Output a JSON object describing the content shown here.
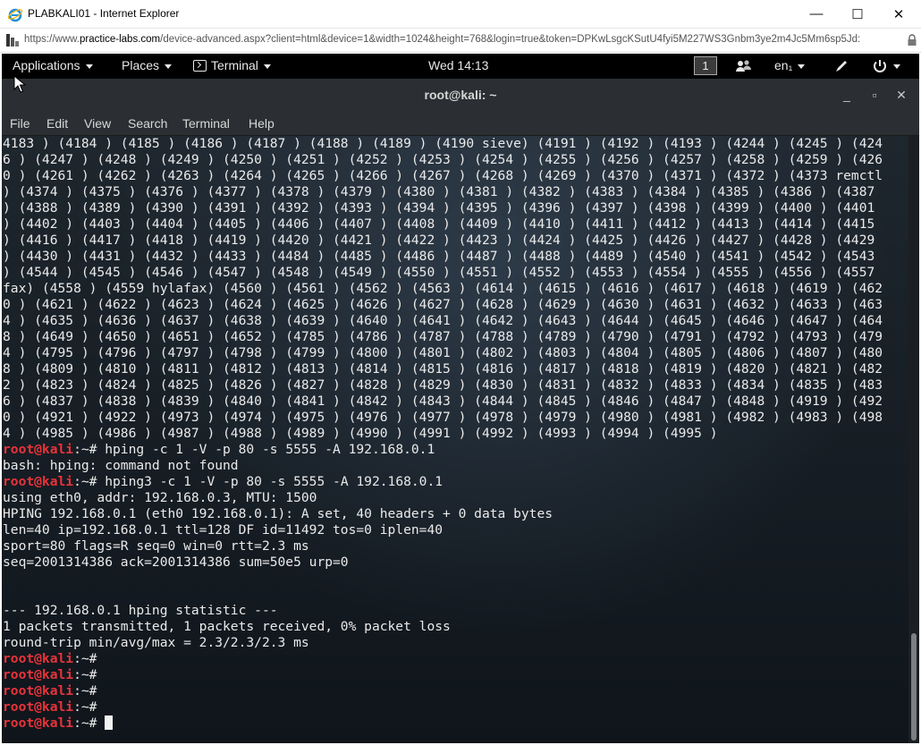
{
  "browser": {
    "window_title": "PLABKALI01 - Internet Explorer",
    "address_prefix": "https://www.",
    "address_host": "practice-labs.com",
    "address_rest": "/device-advanced.aspx?client=html&device=1&width=1024&height=768&login=true&token=DPKwLsgcKSutU4fyi5M227WS3Gnbm3ye2m4Jc5Mm6sp5Jd:",
    "controls": {
      "minimize": "—",
      "maximize": "☐",
      "close": "✕"
    }
  },
  "gnome_bar": {
    "applications": "Applications",
    "places": "Places",
    "terminal": "Terminal",
    "clock": "Wed 14:13",
    "workspace": "1",
    "keyboard": "en₁",
    "icons": [
      "people-icon",
      "keyboard-layout-icon",
      "pen-icon",
      "power-icon"
    ]
  },
  "terminal_window": {
    "title": "root@kali: ~",
    "controls": {
      "minimize": "_",
      "maximize": "▫",
      "close": "✕"
    },
    "menu": [
      "File",
      "Edit",
      "View",
      "Search",
      "Terminal",
      "Help"
    ]
  },
  "terminal": {
    "prompt_user": "root@kali",
    "prompt_path": ":~# ",
    "lines": [
      {
        "t": "out",
        "text": "4183 ) (4184 ) (4185 ) (4186 ) (4187 ) (4188 ) (4189 ) (4190 sieve) (4191 ) (4192 ) (4193 ) (4244 ) (4245 ) (424"
      },
      {
        "t": "out",
        "text": "6 ) (4247 ) (4248 ) (4249 ) (4250 ) (4251 ) (4252 ) (4253 ) (4254 ) (4255 ) (4256 ) (4257 ) (4258 ) (4259 ) (426"
      },
      {
        "t": "out",
        "text": "0 ) (4261 ) (4262 ) (4263 ) (4264 ) (4265 ) (4266 ) (4267 ) (4268 ) (4269 ) (4370 ) (4371 ) (4372 ) (4373 remctl"
      },
      {
        "t": "out",
        "text": ") (4374 ) (4375 ) (4376 ) (4377 ) (4378 ) (4379 ) (4380 ) (4381 ) (4382 ) (4383 ) (4384 ) (4385 ) (4386 ) (4387"
      },
      {
        "t": "out",
        "text": ") (4388 ) (4389 ) (4390 ) (4391 ) (4392 ) (4393 ) (4394 ) (4395 ) (4396 ) (4397 ) (4398 ) (4399 ) (4400 ) (4401"
      },
      {
        "t": "out",
        "text": ") (4402 ) (4403 ) (4404 ) (4405 ) (4406 ) (4407 ) (4408 ) (4409 ) (4410 ) (4411 ) (4412 ) (4413 ) (4414 ) (4415"
      },
      {
        "t": "out",
        "text": ") (4416 ) (4417 ) (4418 ) (4419 ) (4420 ) (4421 ) (4422 ) (4423 ) (4424 ) (4425 ) (4426 ) (4427 ) (4428 ) (4429"
      },
      {
        "t": "out",
        "text": ") (4430 ) (4431 ) (4432 ) (4433 ) (4484 ) (4485 ) (4486 ) (4487 ) (4488 ) (4489 ) (4540 ) (4541 ) (4542 ) (4543"
      },
      {
        "t": "out",
        "text": ") (4544 ) (4545 ) (4546 ) (4547 ) (4548 ) (4549 ) (4550 ) (4551 ) (4552 ) (4553 ) (4554 ) (4555 ) (4556 ) (4557"
      },
      {
        "t": "out",
        "text": "fax) (4558 ) (4559 hylafax) (4560 ) (4561 ) (4562 ) (4563 ) (4614 ) (4615 ) (4616 ) (4617 ) (4618 ) (4619 ) (462"
      },
      {
        "t": "out",
        "text": "0 ) (4621 ) (4622 ) (4623 ) (4624 ) (4625 ) (4626 ) (4627 ) (4628 ) (4629 ) (4630 ) (4631 ) (4632 ) (4633 ) (463"
      },
      {
        "t": "out",
        "text": "4 ) (4635 ) (4636 ) (4637 ) (4638 ) (4639 ) (4640 ) (4641 ) (4642 ) (4643 ) (4644 ) (4645 ) (4646 ) (4647 ) (464"
      },
      {
        "t": "out",
        "text": "8 ) (4649 ) (4650 ) (4651 ) (4652 ) (4785 ) (4786 ) (4787 ) (4788 ) (4789 ) (4790 ) (4791 ) (4792 ) (4793 ) (479"
      },
      {
        "t": "out",
        "text": "4 ) (4795 ) (4796 ) (4797 ) (4798 ) (4799 ) (4800 ) (4801 ) (4802 ) (4803 ) (4804 ) (4805 ) (4806 ) (4807 ) (480"
      },
      {
        "t": "out",
        "text": "8 ) (4809 ) (4810 ) (4811 ) (4812 ) (4813 ) (4814 ) (4815 ) (4816 ) (4817 ) (4818 ) (4819 ) (4820 ) (4821 ) (482"
      },
      {
        "t": "out",
        "text": "2 ) (4823 ) (4824 ) (4825 ) (4826 ) (4827 ) (4828 ) (4829 ) (4830 ) (4831 ) (4832 ) (4833 ) (4834 ) (4835 ) (483"
      },
      {
        "t": "out",
        "text": "6 ) (4837 ) (4838 ) (4839 ) (4840 ) (4841 ) (4842 ) (4843 ) (4844 ) (4845 ) (4846 ) (4847 ) (4848 ) (4919 ) (492"
      },
      {
        "t": "out",
        "text": "0 ) (4921 ) (4922 ) (4973 ) (4974 ) (4975 ) (4976 ) (4977 ) (4978 ) (4979 ) (4980 ) (4981 ) (4982 ) (4983 ) (498"
      },
      {
        "t": "out",
        "text": "4 ) (4985 ) (4986 ) (4987 ) (4988 ) (4989 ) (4990 ) (4991 ) (4992 ) (4993 ) (4994 ) (4995 )"
      },
      {
        "t": "cmd",
        "text": "hping -c 1 -V -p 80 -s 5555 -A 192.168.0.1"
      },
      {
        "t": "out",
        "text": "bash: hping: command not found"
      },
      {
        "t": "cmd",
        "text": "hping3 -c 1 -V -p 80 -s 5555 -A 192.168.0.1"
      },
      {
        "t": "out",
        "text": "using eth0, addr: 192.168.0.3, MTU: 1500"
      },
      {
        "t": "out",
        "text": "HPING 192.168.0.1 (eth0 192.168.0.1): A set, 40 headers + 0 data bytes"
      },
      {
        "t": "out",
        "text": "len=40 ip=192.168.0.1 ttl=128 DF id=11492 tos=0 iplen=40"
      },
      {
        "t": "out",
        "text": "sport=80 flags=R seq=0 win=0 rtt=2.3 ms"
      },
      {
        "t": "out",
        "text": "seq=2001314386 ack=2001314386 sum=50e5 urp=0"
      },
      {
        "t": "out",
        "text": ""
      },
      {
        "t": "out",
        "text": ""
      },
      {
        "t": "out",
        "text": "--- 192.168.0.1 hping statistic ---"
      },
      {
        "t": "out",
        "text": "1 packets transmitted, 1 packets received, 0% packet loss"
      },
      {
        "t": "out",
        "text": "round-trip min/avg/max = 2.3/2.3/2.3 ms"
      },
      {
        "t": "cmd",
        "text": ""
      },
      {
        "t": "cmd",
        "text": ""
      },
      {
        "t": "cmd",
        "text": ""
      },
      {
        "t": "cmd",
        "text": ""
      },
      {
        "t": "cmd",
        "text": "",
        "cursor": true
      }
    ]
  },
  "colors": {
    "prompt": "#e8333a",
    "terminal_text": "#eaeaea",
    "terminal_bg": "#1b1f23",
    "gnome_bar": "#000000"
  }
}
